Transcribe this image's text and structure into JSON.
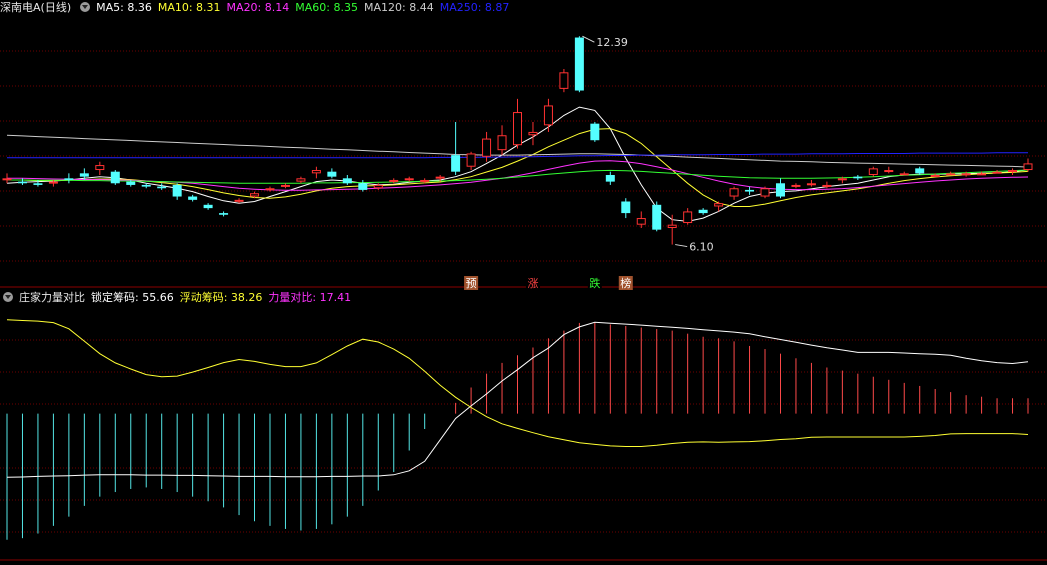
{
  "main_panel": {
    "title": "深南电A(日线)",
    "ma_legend": [
      {
        "label": "MA5: ",
        "value": "8.36",
        "color": "#ffffff"
      },
      {
        "label": "MA10: ",
        "value": "8.31",
        "color": "#ffff33"
      },
      {
        "label": "MA20: ",
        "value": "8.14",
        "color": "#ff33ff"
      },
      {
        "label": "MA60: ",
        "value": "8.35",
        "color": "#33ff33"
      },
      {
        "label": "MA120: ",
        "value": "8.44",
        "color": "#cccccc"
      },
      {
        "label": "MA250: ",
        "value": "8.87",
        "color": "#2222ff"
      }
    ],
    "high_label": "12.39",
    "low_label": "6.10",
    "markers": [
      {
        "text": "预",
        "bg": "#a0522d",
        "color": "#ffffff",
        "index": 30
      },
      {
        "text": "涨",
        "bg": "#000000",
        "color": "#ff4444",
        "index": 34
      },
      {
        "text": "跌",
        "bg": "#000000",
        "color": "#33ff33",
        "index": 38
      },
      {
        "text": "榜",
        "bg": "#a0522d",
        "color": "#ffffff",
        "index": 40
      }
    ]
  },
  "indicator_panel": {
    "title": "庄家力量对比",
    "values": [
      {
        "label": "锁定筹码: ",
        "value": "55.66",
        "color": "#ffffff"
      },
      {
        "label": "浮动筹码: ",
        "value": "38.26",
        "color": "#ffff33"
      },
      {
        "label": "力量对比: ",
        "value": "17.41",
        "color": "#ff33ff"
      }
    ]
  },
  "chart_data": {
    "type": "candlestick",
    "price_range": [
      5.0,
      13.0
    ],
    "candles": [
      [
        8.05,
        8.25,
        7.95,
        8.1
      ],
      [
        8.0,
        8.1,
        7.9,
        7.95
      ],
      [
        7.95,
        8.05,
        7.85,
        7.9
      ],
      [
        7.95,
        8.05,
        7.85,
        8.0
      ],
      [
        8.1,
        8.25,
        7.95,
        8.05
      ],
      [
        8.25,
        8.4,
        8.05,
        8.15
      ],
      [
        8.35,
        8.6,
        8.2,
        8.5
      ],
      [
        8.3,
        8.35,
        7.9,
        7.95
      ],
      [
        8.0,
        8.05,
        7.85,
        7.9
      ],
      [
        7.9,
        7.95,
        7.8,
        7.85
      ],
      [
        7.85,
        7.95,
        7.75,
        7.8
      ],
      [
        7.9,
        7.95,
        7.45,
        7.55
      ],
      [
        7.55,
        7.6,
        7.4,
        7.45
      ],
      [
        7.3,
        7.35,
        7.15,
        7.2
      ],
      [
        7.05,
        7.1,
        6.95,
        7.0
      ],
      [
        7.4,
        7.5,
        7.35,
        7.45
      ],
      [
        7.55,
        7.7,
        7.5,
        7.65
      ],
      [
        7.75,
        7.85,
        7.7,
        7.8
      ],
      [
        7.85,
        7.95,
        7.8,
        7.9
      ],
      [
        8.0,
        8.15,
        7.95,
        8.1
      ],
      [
        8.25,
        8.45,
        8.1,
        8.35
      ],
      [
        8.3,
        8.4,
        8.1,
        8.15
      ],
      [
        8.1,
        8.2,
        7.9,
        7.95
      ],
      [
        7.95,
        8.05,
        7.7,
        7.75
      ],
      [
        7.8,
        7.95,
        7.75,
        7.9
      ],
      [
        8.0,
        8.1,
        7.95,
        8.05
      ],
      [
        8.05,
        8.15,
        8.0,
        8.1
      ],
      [
        8.0,
        8.1,
        7.95,
        8.05
      ],
      [
        8.1,
        8.2,
        8.0,
        8.15
      ],
      [
        8.8,
        9.8,
        8.2,
        8.3
      ],
      [
        8.45,
        8.9,
        8.35,
        8.85
      ],
      [
        8.75,
        9.5,
        8.6,
        9.3
      ],
      [
        8.95,
        9.7,
        8.8,
        9.4
      ],
      [
        9.1,
        10.5,
        9.0,
        10.1
      ],
      [
        9.4,
        9.8,
        9.1,
        9.5
      ],
      [
        9.7,
        10.5,
        9.5,
        10.3
      ],
      [
        10.8,
        11.4,
        10.7,
        11.3
      ],
      [
        12.35,
        12.39,
        10.7,
        10.75
      ],
      [
        9.75,
        9.8,
        9.2,
        9.25
      ],
      [
        8.2,
        8.3,
        7.9,
        8.0
      ],
      [
        7.4,
        7.5,
        6.9,
        7.05
      ],
      [
        6.7,
        7.1,
        6.6,
        6.9
      ],
      [
        7.3,
        7.4,
        6.5,
        6.55
      ],
      [
        6.6,
        7.0,
        6.1,
        6.7
      ],
      [
        6.75,
        7.2,
        6.7,
        7.1
      ],
      [
        7.15,
        7.2,
        7.0,
        7.05
      ],
      [
        7.25,
        7.4,
        7.1,
        7.35
      ],
      [
        7.55,
        7.85,
        7.45,
        7.8
      ],
      [
        7.75,
        7.85,
        7.6,
        7.7
      ],
      [
        7.55,
        7.85,
        7.5,
        7.8
      ],
      [
        7.95,
        8.1,
        7.5,
        7.55
      ],
      [
        7.85,
        7.95,
        7.8,
        7.9
      ],
      [
        7.95,
        8.05,
        7.85,
        7.95
      ],
      [
        7.9,
        8.0,
        7.8,
        7.9
      ],
      [
        8.05,
        8.15,
        7.95,
        8.1
      ],
      [
        8.15,
        8.2,
        8.05,
        8.1
      ],
      [
        8.2,
        8.45,
        8.15,
        8.4
      ],
      [
        8.3,
        8.45,
        8.25,
        8.35
      ],
      [
        8.25,
        8.3,
        8.2,
        8.25
      ],
      [
        8.4,
        8.45,
        8.2,
        8.25
      ],
      [
        8.2,
        8.25,
        8.15,
        8.2
      ],
      [
        8.25,
        8.3,
        8.2,
        8.25
      ],
      [
        8.2,
        8.3,
        8.15,
        8.25
      ],
      [
        8.25,
        8.3,
        8.2,
        8.25
      ],
      [
        8.3,
        8.35,
        8.25,
        8.3
      ],
      [
        8.3,
        8.4,
        8.2,
        8.35
      ],
      [
        8.35,
        8.7,
        8.3,
        8.55
      ]
    ],
    "ma_lines": {
      "MA5": [
        7.95,
        7.98,
        8.0,
        8.02,
        8.05,
        8.1,
        8.15,
        8.12,
        8.05,
        7.95,
        7.88,
        7.8,
        7.7,
        7.55,
        7.42,
        7.35,
        7.4,
        7.55,
        7.7,
        7.85,
        8.0,
        8.05,
        8.02,
        7.95,
        7.9,
        7.92,
        7.98,
        8.02,
        8.05,
        8.15,
        8.3,
        8.55,
        8.8,
        9.1,
        9.35,
        9.65,
        10.0,
        10.25,
        10.15,
        9.6,
        8.7,
        7.9,
        7.2,
        6.85,
        6.8,
        6.9,
        7.1,
        7.35,
        7.55,
        7.65,
        7.7,
        7.72,
        7.78,
        7.85,
        7.9,
        7.95,
        8.05,
        8.15,
        8.2,
        8.22,
        8.22,
        8.23,
        8.24,
        8.25,
        8.26,
        8.3,
        8.36
      ],
      "MA10": [
        8.05,
        8.05,
        8.03,
        8.03,
        8.04,
        8.06,
        8.08,
        8.08,
        8.06,
        8.02,
        7.97,
        7.92,
        7.85,
        7.76,
        7.66,
        7.58,
        7.52,
        7.5,
        7.54,
        7.62,
        7.72,
        7.8,
        7.85,
        7.87,
        7.88,
        7.9,
        7.93,
        7.96,
        7.99,
        8.06,
        8.15,
        8.29,
        8.43,
        8.62,
        8.82,
        9.05,
        9.25,
        9.45,
        9.58,
        9.6,
        9.45,
        9.15,
        8.75,
        8.35,
        7.95,
        7.6,
        7.35,
        7.25,
        7.25,
        7.32,
        7.42,
        7.52,
        7.6,
        7.66,
        7.72,
        7.78,
        7.86,
        7.95,
        8.03,
        8.09,
        8.14,
        8.18,
        8.21,
        8.24,
        8.26,
        8.28,
        8.31
      ],
      "MA20": [
        8.1,
        8.1,
        8.09,
        8.08,
        8.07,
        8.06,
        8.06,
        8.05,
        8.04,
        8.02,
        8.0,
        7.98,
        7.95,
        7.9,
        7.85,
        7.8,
        7.77,
        7.75,
        7.74,
        7.74,
        7.75,
        7.76,
        7.77,
        7.78,
        7.8,
        7.82,
        7.84,
        7.87,
        7.9,
        7.94,
        7.98,
        8.04,
        8.1,
        8.18,
        8.27,
        8.37,
        8.47,
        8.56,
        8.62,
        8.63,
        8.6,
        8.54,
        8.45,
        8.35,
        8.24,
        8.13,
        8.02,
        7.92,
        7.85,
        7.8,
        7.77,
        7.76,
        7.76,
        7.77,
        7.79,
        7.82,
        7.86,
        7.9,
        7.94,
        7.98,
        8.02,
        8.05,
        8.08,
        8.1,
        8.12,
        8.13,
        8.14
      ],
      "MA60": [
        8.05,
        8.05,
        8.04,
        8.04,
        8.04,
        8.03,
        8.03,
        8.02,
        8.02,
        8.01,
        8.0,
        7.99,
        7.98,
        7.97,
        7.96,
        7.95,
        7.95,
        7.95,
        7.95,
        7.95,
        7.96,
        7.96,
        7.97,
        7.97,
        7.98,
        7.99,
        8.0,
        8.01,
        8.02,
        8.03,
        8.05,
        8.07,
        8.1,
        8.14,
        8.18,
        8.22,
        8.26,
        8.3,
        8.33,
        8.34,
        8.33,
        8.31,
        8.28,
        8.25,
        8.22,
        8.19,
        8.16,
        8.14,
        8.12,
        8.11,
        8.1,
        8.1,
        8.1,
        8.11,
        8.12,
        8.13,
        8.15,
        8.17,
        8.19,
        8.21,
        8.23,
        8.25,
        8.27,
        8.29,
        8.31,
        8.33,
        8.35
      ],
      "MA120": [
        9.4,
        9.38,
        9.36,
        9.34,
        9.32,
        9.3,
        9.28,
        9.26,
        9.24,
        9.22,
        9.2,
        9.18,
        9.16,
        9.14,
        9.12,
        9.1,
        9.08,
        9.06,
        9.04,
        9.02,
        9.0,
        8.98,
        8.96,
        8.94,
        8.92,
        8.9,
        8.88,
        8.86,
        8.84,
        8.82,
        8.81,
        8.8,
        8.8,
        8.8,
        8.81,
        8.82,
        8.83,
        8.84,
        8.84,
        8.83,
        8.82,
        8.8,
        8.78,
        8.76,
        8.74,
        8.72,
        8.7,
        8.68,
        8.66,
        8.64,
        8.62,
        8.61,
        8.6,
        8.58,
        8.57,
        8.56,
        8.55,
        8.54,
        8.53,
        8.52,
        8.51,
        8.5,
        8.49,
        8.48,
        8.47,
        8.46,
        8.44
      ],
      "MA250": [
        8.72,
        8.72,
        8.72,
        8.72,
        8.72,
        8.72,
        8.72,
        8.72,
        8.72,
        8.72,
        8.72,
        8.72,
        8.72,
        8.72,
        8.72,
        8.72,
        8.72,
        8.72,
        8.72,
        8.72,
        8.72,
        8.72,
        8.72,
        8.72,
        8.72,
        8.72,
        8.72,
        8.72,
        8.73,
        8.73,
        8.73,
        8.74,
        8.74,
        8.75,
        8.75,
        8.76,
        8.77,
        8.78,
        8.78,
        8.79,
        8.79,
        8.8,
        8.8,
        8.81,
        8.81,
        8.81,
        8.82,
        8.82,
        8.82,
        8.83,
        8.83,
        8.83,
        8.84,
        8.84,
        8.84,
        8.85,
        8.85,
        8.85,
        8.85,
        8.86,
        8.86,
        8.86,
        8.86,
        8.86,
        8.87,
        8.87,
        8.87
      ]
    },
    "indicator": {
      "range": [
        -45,
        35
      ],
      "locked_chips": [
        -20.7,
        -20.6,
        -20.4,
        -20.3,
        -20.2,
        -20.0,
        -19.9,
        -19.9,
        -19.9,
        -20.0,
        -20.0,
        -20.1,
        -20.1,
        -20.2,
        -20.3,
        -20.4,
        -20.4,
        -20.4,
        -20.5,
        -20.5,
        -20.5,
        -20.4,
        -20.4,
        -20.3,
        -20.3,
        -19.9,
        -18.6,
        -15.5,
        -8.5,
        -1.6,
        2.5,
        6.4,
        10.6,
        14.3,
        18.2,
        21.3,
        25.7,
        28.2,
        29.7,
        29.4,
        29.1,
        28.8,
        28.4,
        28.1,
        27.7,
        27.3,
        26.9,
        26.5,
        26.0,
        25.0,
        24.1,
        23.2,
        22.3,
        21.4,
        20.7,
        19.9,
        19.9,
        19.9,
        19.7,
        19.5,
        19.3,
        19.0,
        18.0,
        17.2,
        16.6,
        16.3,
        16.9
      ],
      "floating_chips": [
        30.5,
        30.3,
        30.1,
        29.6,
        27.6,
        23.6,
        19.5,
        16.5,
        14.5,
        12.7,
        12.0,
        12.2,
        13.5,
        15.0,
        16.6,
        17.6,
        17.0,
        16.0,
        15.3,
        15.3,
        16.5,
        19.2,
        22.0,
        24.2,
        23.3,
        21.0,
        18.0,
        13.8,
        9.2,
        5.3,
        2.0,
        -1.0,
        -3.3,
        -4.8,
        -6.2,
        -7.5,
        -8.5,
        -9.5,
        -10.0,
        -10.5,
        -10.7,
        -10.7,
        -10.3,
        -9.7,
        -9.3,
        -9.2,
        -9.3,
        -9.2,
        -9.1,
        -8.8,
        -8.4,
        -8.2,
        -7.7,
        -7.6,
        -7.6,
        -7.6,
        -7.6,
        -7.6,
        -7.6,
        -7.4,
        -7.1,
        -6.6,
        -6.5,
        -6.5,
        -6.5,
        -6.5,
        -6.8
      ],
      "power_ratio": [
        -41.0,
        -40.5,
        -39.0,
        -36.5,
        -33.5,
        -30.0,
        -27.0,
        -25.5,
        -24.5,
        -24.0,
        -24.5,
        -25.5,
        -27.0,
        -28.5,
        -30.5,
        -33.0,
        -35.0,
        -36.5,
        -37.5,
        -38.0,
        -37.5,
        -36.0,
        -33.5,
        -30.0,
        -25.0,
        -19.0,
        -12.0,
        -5.0,
        0.0,
        3.5,
        8.5,
        13.0,
        16.5,
        19.0,
        21.5,
        24.5,
        27.0,
        29.5,
        29.5,
        29.0,
        28.5,
        28.0,
        27.5,
        27.0,
        26.0,
        25.0,
        24.5,
        23.5,
        22.0,
        21.0,
        19.5,
        18.0,
        16.5,
        15.0,
        14.0,
        13.0,
        12.0,
        11.0,
        10.0,
        9.0,
        8.0,
        7.0,
        6.0,
        5.5,
        5.0,
        5.0,
        5.0
      ]
    }
  }
}
